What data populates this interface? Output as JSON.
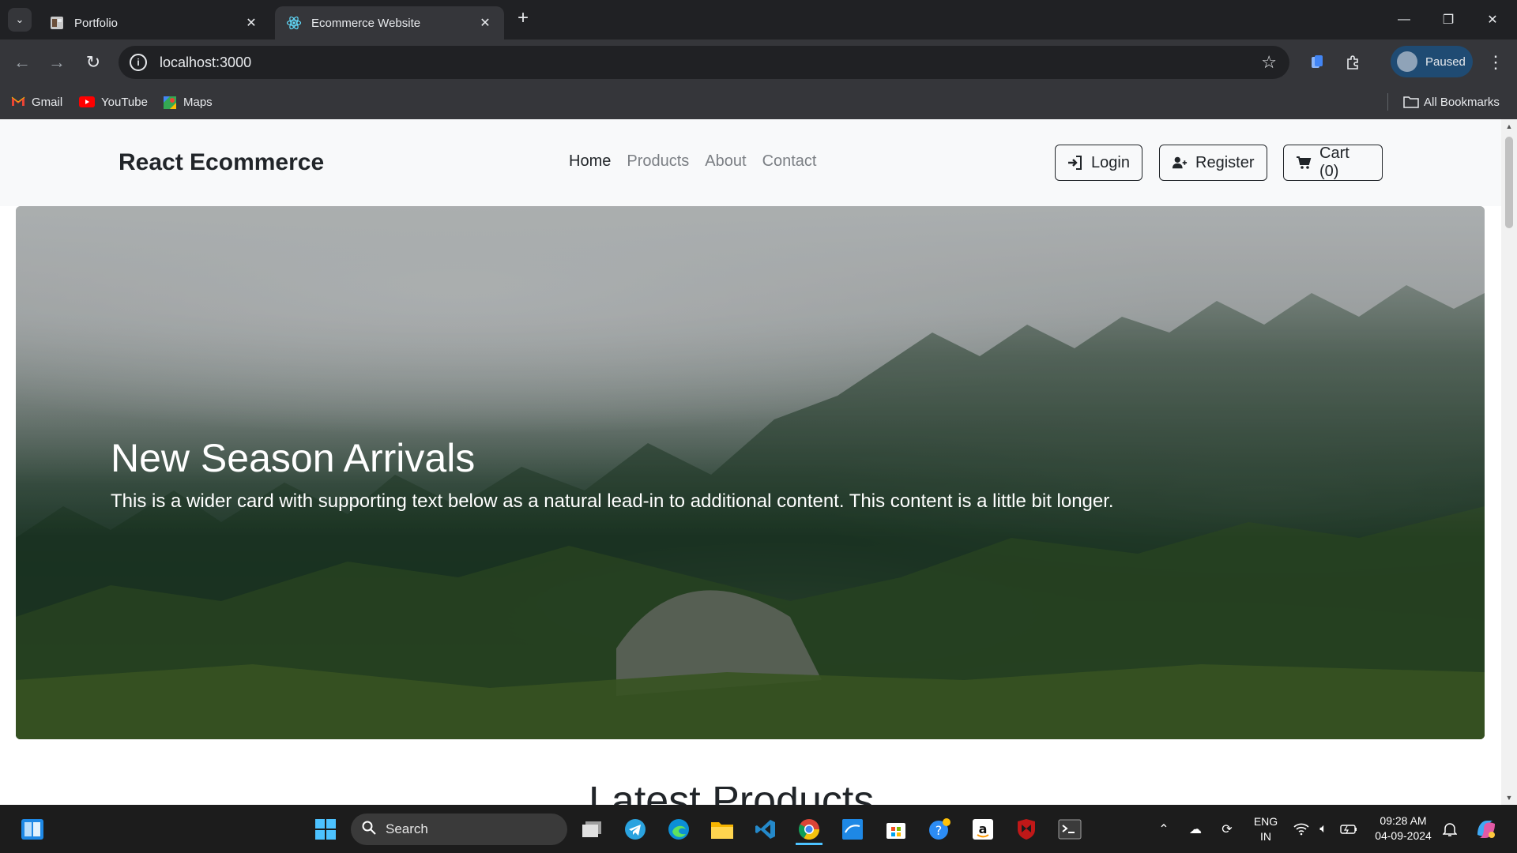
{
  "browser": {
    "tabs": [
      {
        "title": "Portfolio",
        "active": false
      },
      {
        "title": "Ecommerce Website",
        "active": true
      }
    ],
    "url": "localhost:3000",
    "profile_label": "Paused",
    "bookmarks": [
      {
        "label": "Gmail",
        "icon": "gmail-icon"
      },
      {
        "label": "YouTube",
        "icon": "youtube-icon"
      },
      {
        "label": "Maps",
        "icon": "maps-icon"
      }
    ],
    "all_bookmarks_label": "All Bookmarks"
  },
  "site": {
    "brand": "React Ecommerce",
    "nav": [
      {
        "label": "Home",
        "active": true
      },
      {
        "label": "Products",
        "active": false
      },
      {
        "label": "About",
        "active": false
      },
      {
        "label": "Contact",
        "active": false
      }
    ],
    "buttons": {
      "login": "Login",
      "register": "Register",
      "cart": "Cart (0)"
    },
    "hero": {
      "title": "New Season Arrivals",
      "text": "This is a wider card with supporting text below as a natural lead-in to additional content. This content is a little bit longer."
    },
    "next_section_title": "Latest Products"
  },
  "taskbar": {
    "search_placeholder": "Search",
    "lang_top": "ENG",
    "lang_bottom": "IN",
    "time": "09:28 AM",
    "date": "04-09-2024"
  },
  "colors": {
    "tab_bg": "#202124",
    "toolbar_bg": "#35363a",
    "navbar_bg": "#f8f9fa",
    "profile_bg": "#1f4b73",
    "taskbar_bg": "#1c1c1c"
  }
}
